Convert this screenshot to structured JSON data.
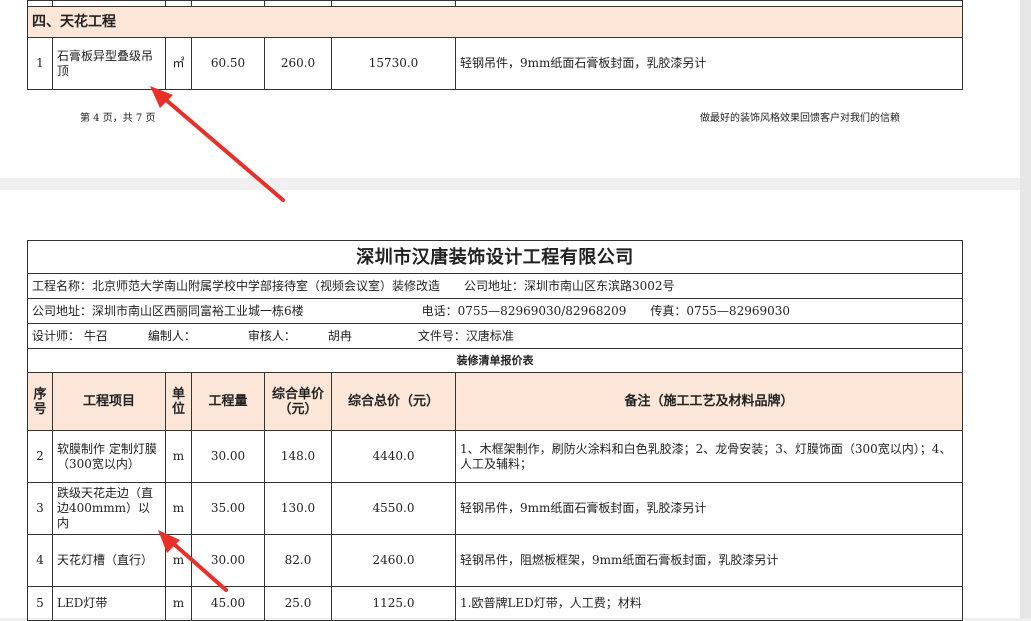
{
  "top_page": {
    "section_title": "四、天花工程",
    "row": {
      "no": "1",
      "item": "石膏板异型叠级吊顶",
      "unit": "㎡",
      "qty": "60.50",
      "unit_price": "260.0",
      "total": "15730.0",
      "note": "轻钢吊件，9mm纸面石膏板封面，乳胶漆另计"
    },
    "footer_left": "第 4 页，共 7 页",
    "footer_right": "做最好的装饰风格效果回馈客户对我们的信赖"
  },
  "bottom_page": {
    "company": "深圳市汉唐装饰设计工程有限公司",
    "project_name": "工程名称：北京师范大学南山附属学校中学部接待室（视频会议室）装修改造",
    "company_address_right": "公司地址：深圳市南山区东滨路3002号",
    "company_address_left": "公司地址：深圳市南山区西丽同富裕工业城一栋6楼",
    "phone": "电话：0755—82969030/82968209",
    "fax": "传真：0755—82969030",
    "designer": "设计师：  牛召",
    "editor": "编制人：",
    "reviewer": "审核人：",
    "reviewer_name": "胡冉",
    "file_no": "文件号：汉唐标准",
    "sheet_title": "装修清单报价表",
    "headers": {
      "no": "序号",
      "item": "工程项目",
      "unit": "单位",
      "qty": "工程量",
      "unit_price": "综合单价（元）",
      "total": "综合总价（元）",
      "note": "备注（施工工艺及材料品牌）"
    },
    "rows": [
      {
        "no": "2",
        "item": "软膜制作 定制灯膜（300宽以内）",
        "unit": "m",
        "qty": "30.00",
        "unit_price": "148.0",
        "total": "4440.0",
        "note": "1、木框架制作，刷防火涂料和白色乳胶漆；2、龙骨安装；3、灯膜饰面（300宽以内）；4、人工及辅料；"
      },
      {
        "no": "3",
        "item": "跌级天花走边（直边400mmm）以内",
        "unit": "m",
        "qty": "35.00",
        "unit_price": "130.0",
        "total": "4550.0",
        "note": "轻钢吊件，9mm纸面石膏板封面，乳胶漆另计"
      },
      {
        "no": "4",
        "item": "天花灯槽（直行）",
        "unit": "m",
        "qty": "30.00",
        "unit_price": "82.0",
        "total": "2460.0",
        "note": "轻钢吊件，阻燃板框架，9mm纸面石膏板封面，乳胶漆另计"
      },
      {
        "no": "5",
        "item": "LED灯带",
        "unit": "m",
        "qty": "45.00",
        "unit_price": "25.0",
        "total": "1125.0",
        "note": "1.欧普牌LED灯带，人工费；材料"
      }
    ]
  },
  "colors": {
    "header_fill": "#fbe6d8",
    "arrow": "#e8302a",
    "border": "#333333"
  }
}
